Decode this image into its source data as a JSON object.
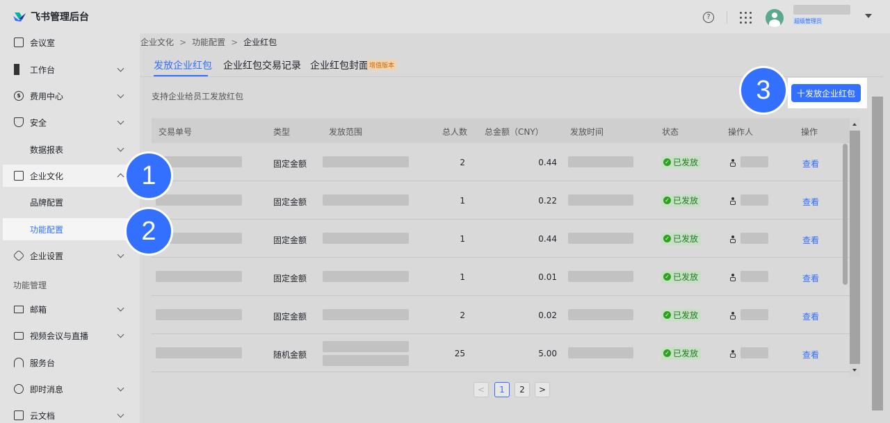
{
  "header": {
    "app_title": "飞书管理后台",
    "help_glyph": "?",
    "role_badge": "超级管理员"
  },
  "sidebar": {
    "items": [
      {
        "label": "会议室"
      },
      {
        "label": "工作台"
      },
      {
        "label": "费用中心",
        "icon_glyph": "$"
      },
      {
        "label": "安全"
      },
      {
        "label": "数据报表"
      },
      {
        "label": "企业文化"
      },
      {
        "label": "品牌配置"
      },
      {
        "label": "功能配置"
      },
      {
        "label": "企业设置"
      }
    ],
    "section_label": "功能管理",
    "items2": [
      {
        "label": "邮箱"
      },
      {
        "label": "视频会议与直播"
      },
      {
        "label": "服务台"
      },
      {
        "label": "即时消息"
      },
      {
        "label": "云文档"
      }
    ]
  },
  "breadcrumb": [
    "企业文化",
    "功能配置",
    "企业红包"
  ],
  "breadcrumb_sep": ">",
  "tabs": [
    {
      "label": "发放企业红包"
    },
    {
      "label": "企业红包交易记录"
    },
    {
      "label": "企业红包封面"
    }
  ],
  "tab_badge": "增值版本",
  "description": "支持企业给员工发放红包",
  "cta_label": "十发放企业红包",
  "steps": [
    "1",
    "2",
    "3"
  ],
  "table": {
    "headers": [
      "交易单号",
      "类型",
      "发放范围",
      "总人数",
      "总金额（CNY）",
      "发放时间",
      "状态",
      "操作人",
      "操作"
    ],
    "rows": [
      {
        "type": "固定金额",
        "count": "2",
        "amount": "0.44",
        "status": "已发放",
        "action": "查看"
      },
      {
        "type": "固定金额",
        "count": "1",
        "amount": "0.22",
        "status": "已发放",
        "action": "查看"
      },
      {
        "type": "固定金额",
        "count": "1",
        "amount": "0.44",
        "status": "已发放",
        "action": "查看"
      },
      {
        "type": "固定金额",
        "count": "1",
        "amount": "0.01",
        "status": "已发放",
        "action": "查看"
      },
      {
        "type": "固定金额",
        "count": "2",
        "amount": "0.02",
        "status": "已发放",
        "action": "查看"
      },
      {
        "type": "随机金额",
        "count": "25",
        "amount": "5.00",
        "status": "已发放",
        "action": "查看"
      }
    ],
    "status_check": "✓"
  },
  "pagination": {
    "prev": "<",
    "pages": [
      "1",
      "2"
    ],
    "next": ">",
    "current": "1"
  }
}
